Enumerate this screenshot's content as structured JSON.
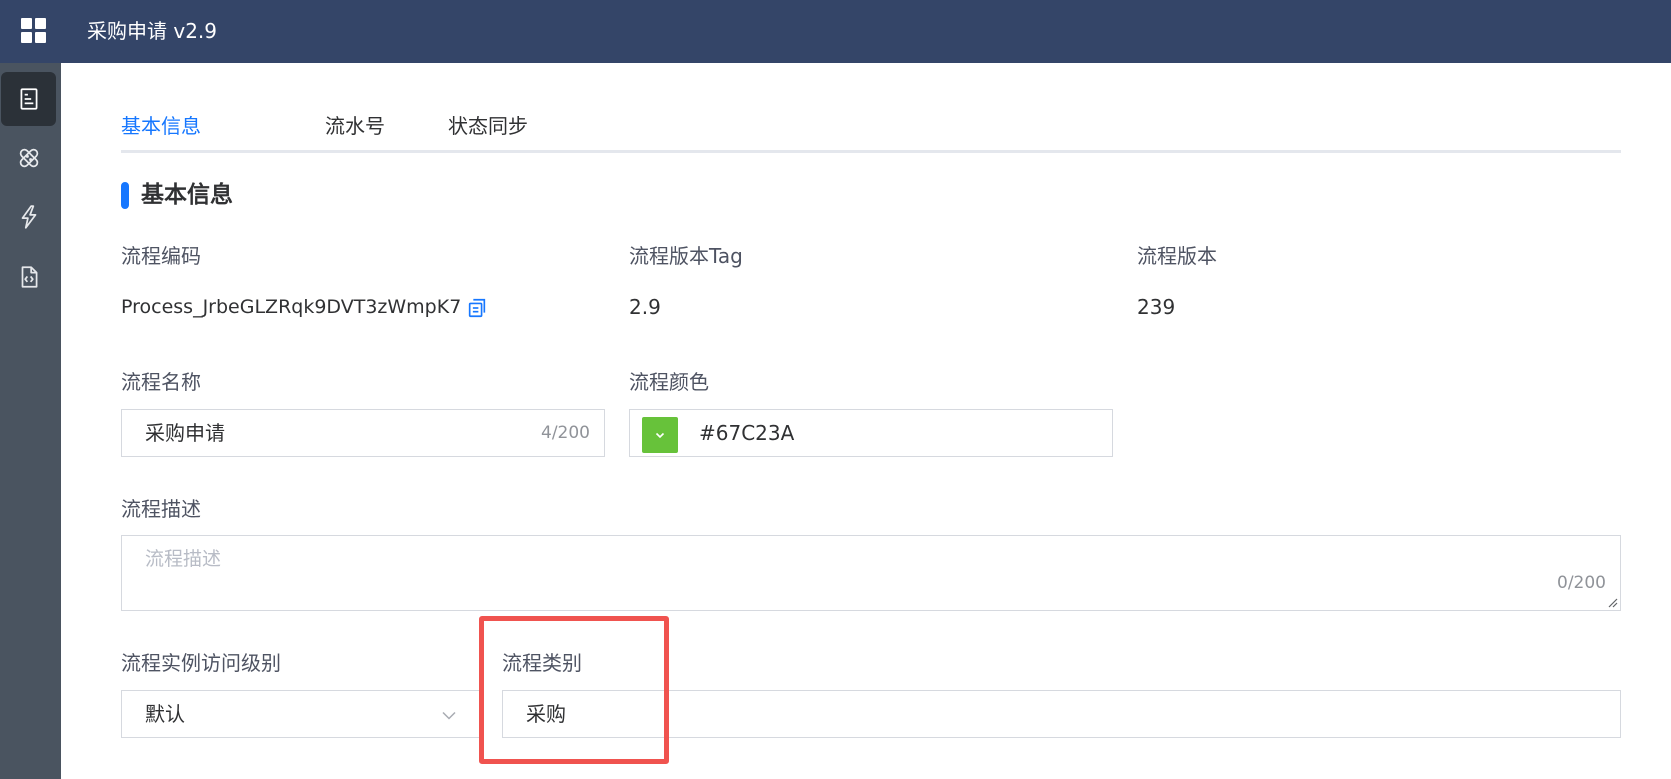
{
  "header": {
    "title": "采购申请 v2.9"
  },
  "sidebar": {
    "items": [
      {
        "icon": "document-icon",
        "active": true
      },
      {
        "icon": "bandage-icon",
        "active": false
      },
      {
        "icon": "lightning-icon",
        "active": false
      },
      {
        "icon": "code-file-icon",
        "active": false
      }
    ]
  },
  "tabs": [
    {
      "label": "基本信息",
      "active": true
    },
    {
      "label": "流水号",
      "active": false
    },
    {
      "label": "状态同步",
      "active": false
    }
  ],
  "section": {
    "title": "基本信息"
  },
  "fields": {
    "process_code": {
      "label": "流程编码",
      "value": "Process_JrbeGLZRqk9DVT3zWmpK7"
    },
    "version_tag": {
      "label": "流程版本Tag",
      "value": "2.9"
    },
    "version": {
      "label": "流程版本",
      "value": "239"
    },
    "process_name": {
      "label": "流程名称",
      "value": "采购申请",
      "counter": "4/200"
    },
    "process_color": {
      "label": "流程颜色",
      "value": "#67C23A",
      "color": "#67C23A"
    },
    "description": {
      "label": "流程描述",
      "placeholder": "流程描述",
      "counter": "0/200"
    },
    "access_level": {
      "label": "流程实例访问级别",
      "value": "默认"
    },
    "category": {
      "label": "流程类别",
      "value": "采购"
    }
  },
  "colors": {
    "accent": "#1677ff",
    "header_bg": "#344568",
    "sidebar_bg": "#4a5460",
    "highlight": "#f0534f"
  }
}
